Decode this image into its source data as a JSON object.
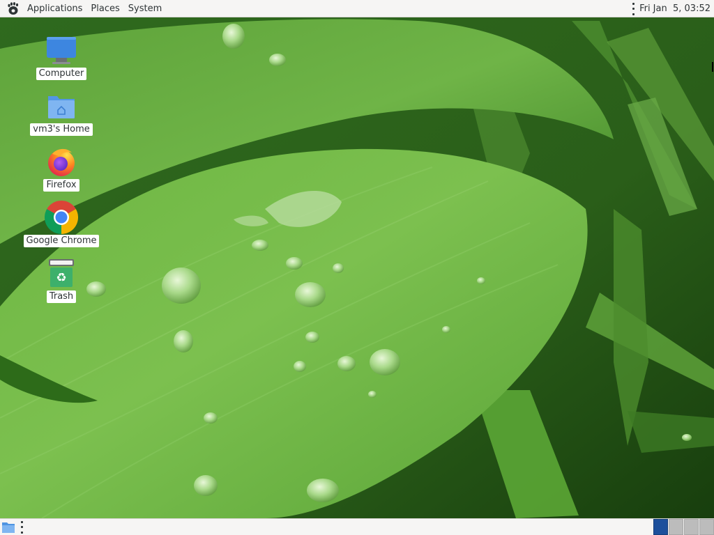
{
  "top_panel": {
    "menus": [
      "Applications",
      "Places",
      "System"
    ],
    "clock": "Fri Jan  5, 03:52"
  },
  "desktop_icons": [
    {
      "label": "Computer",
      "icon": "computer-icon"
    },
    {
      "label": "vm3's Home",
      "icon": "home-folder-icon"
    },
    {
      "label": "Firefox",
      "icon": "firefox-icon"
    },
    {
      "label": "Google Chrome",
      "icon": "chrome-icon"
    },
    {
      "label": "Trash",
      "icon": "trash-icon"
    }
  ],
  "bottom_panel": {
    "workspaces": 4,
    "active_workspace": 1
  },
  "colors": {
    "panel_bg": "#f6f5f4",
    "workspace_active": "#1c4f9c",
    "workspace_inactive": "#bcbcbc"
  }
}
